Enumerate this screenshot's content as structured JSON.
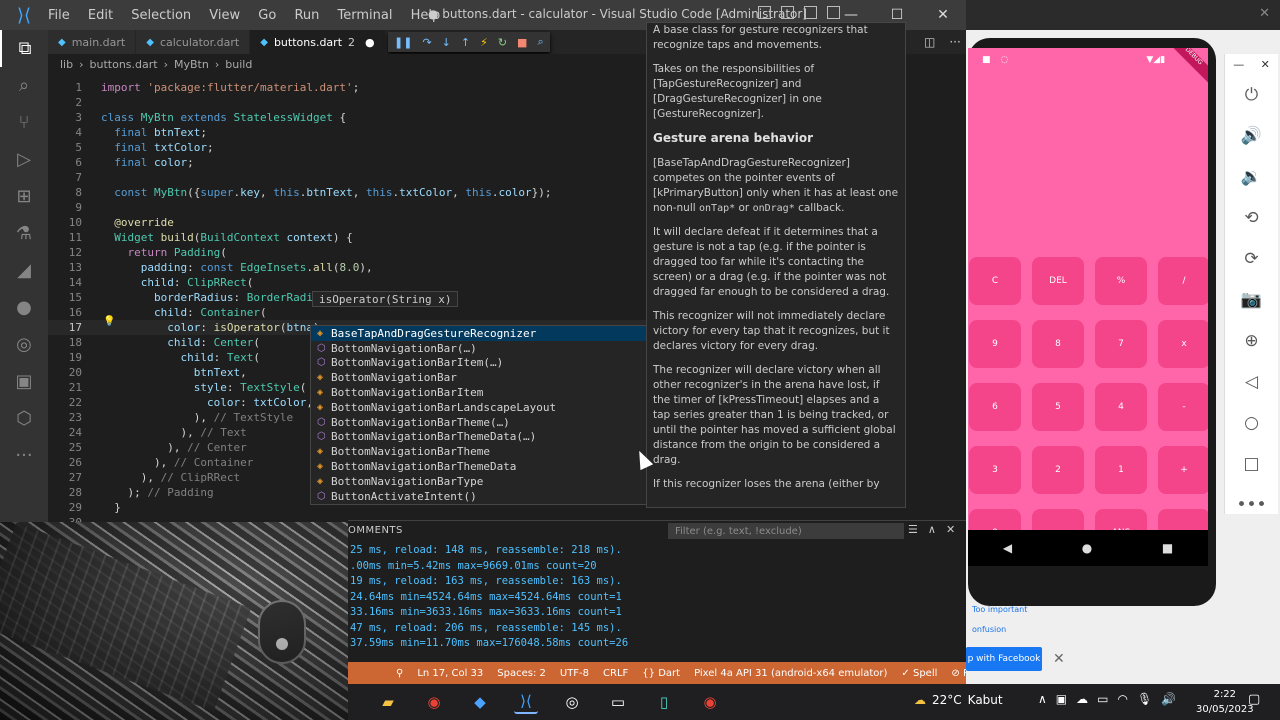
{
  "window": {
    "title": "● buttons.dart - calculator - Visual Studio Code [Administrator]",
    "menu": [
      "File",
      "Edit",
      "Selection",
      "View",
      "Go",
      "Run",
      "Terminal",
      "Help"
    ]
  },
  "tabs": [
    {
      "label": "main.dart",
      "badge": ""
    },
    {
      "label": "calculator.dart",
      "badge": ""
    },
    {
      "label": "buttons.dart",
      "badge": "2"
    }
  ],
  "breadcrumb": [
    "lib",
    "buttons.dart",
    "MyBtn",
    "build"
  ],
  "editor": {
    "line_numbers": [
      "1",
      "2",
      "3",
      "4",
      "5",
      "6",
      "7",
      "8",
      "9",
      "10",
      "11",
      "12",
      "13",
      "14",
      "15",
      "16",
      "17",
      "18",
      "19",
      "20",
      "21",
      "22",
      "23",
      "24",
      "25",
      "26",
      "27",
      "28",
      "29",
      "30"
    ],
    "signature_help": "isOperator(String x)"
  },
  "suggestions": [
    "BaseTapAndDragGestureRecognizer",
    "BottomNavigationBar(…)",
    "BottomNavigationBarItem(…)",
    "BottomNavigationBar",
    "BottomNavigationBarItem",
    "BottomNavigationBarLandscapeLayout",
    "BottomNavigationBarTheme(…)",
    "BottomNavigationBarThemeData(…)",
    "BottomNavigationBarTheme",
    "BottomNavigationBarThemeData",
    "BottomNavigationBarType",
    "ButtonActivateIntent()"
  ],
  "doc": {
    "p1": "A base class for gesture recognizers that recognize taps and movements.",
    "p2": "Takes on the responsibilities of [TapGestureRecognizer] and [DragGestureRecognizer] in one [GestureRecognizer].",
    "heading": "Gesture arena behavior",
    "p3": "[BaseTapAndDragGestureRecognizer] competes on the pointer events of [kPrimaryButton] only when it has at least one non-null",
    "p3_code1": "onTap*",
    "p3_or": "or",
    "p3_code2": "onDrag*",
    "p3_end": "callback.",
    "p4": "It will declare defeat if it determines that a gesture is not a tap (e.g. if the pointer is dragged too far while it's contacting the screen) or a drag (e.g. if the pointer was not dragged far enough to be considered a drag.",
    "p5": "This recognizer will not immediately declare victory for every tap that it recognizes, but it declares victory for every drag.",
    "p6": "The recognizer will declare victory when all other recognizer's in the arena have lost, if the timer of [kPressTimeout] elapses and a tap series greater than 1 is being tracked, or until the pointer has moved a sufficient global distance from the origin to be considered a drag.",
    "p7": "If this recognizer loses the arena (either by"
  },
  "panel": {
    "label": "OMMENTS",
    "filter_placeholder": "Filter (e.g. text, !exclude)",
    "output": [
      "25 ms, reload: 148 ms, reassemble: 218 ms).",
      ".00ms min=5.42ms max=9669.01ms count=20",
      "19 ms, reload: 163 ms, reassemble: 163 ms).",
      "24.64ms min=4524.64ms max=4524.64ms count=1",
      "33.16ms min=3633.16ms max=3633.16ms count=1",
      "47 ms, reload: 206 ms, reassemble: 145 ms).",
      "37.59ms min=11.70ms max=176048.58ms count=26"
    ]
  },
  "statusbar": [
    "Ln 17, Col 33",
    "Spaces: 2",
    "UTF-8",
    "CRLF",
    "{} Dart",
    "Pixel 4a API 31 (android-x64 emulator)",
    "✓ Spell",
    "⊘ Prettier"
  ],
  "calculator": {
    "buttons": [
      "C",
      "DEL",
      "%",
      "/",
      "9",
      "8",
      "7",
      "x",
      "6",
      "5",
      "4",
      "-",
      "3",
      "2",
      "1",
      "+",
      "0",
      ".",
      "ANS",
      "="
    ]
  },
  "emulator": {
    "debug_banner": "DEBUG"
  },
  "background": {
    "link1": "Too important",
    "link2": "onfusion",
    "fb_button": "p with Facebook"
  },
  "taskbar": {
    "weather_temp": "22°C",
    "weather_text": "Kabut",
    "time": "2:22",
    "date": "30/05/2023"
  },
  "colors": {
    "status_bar": "#cc6633",
    "calc_background": "#ff66aa",
    "calc_button": "#f4448a"
  }
}
